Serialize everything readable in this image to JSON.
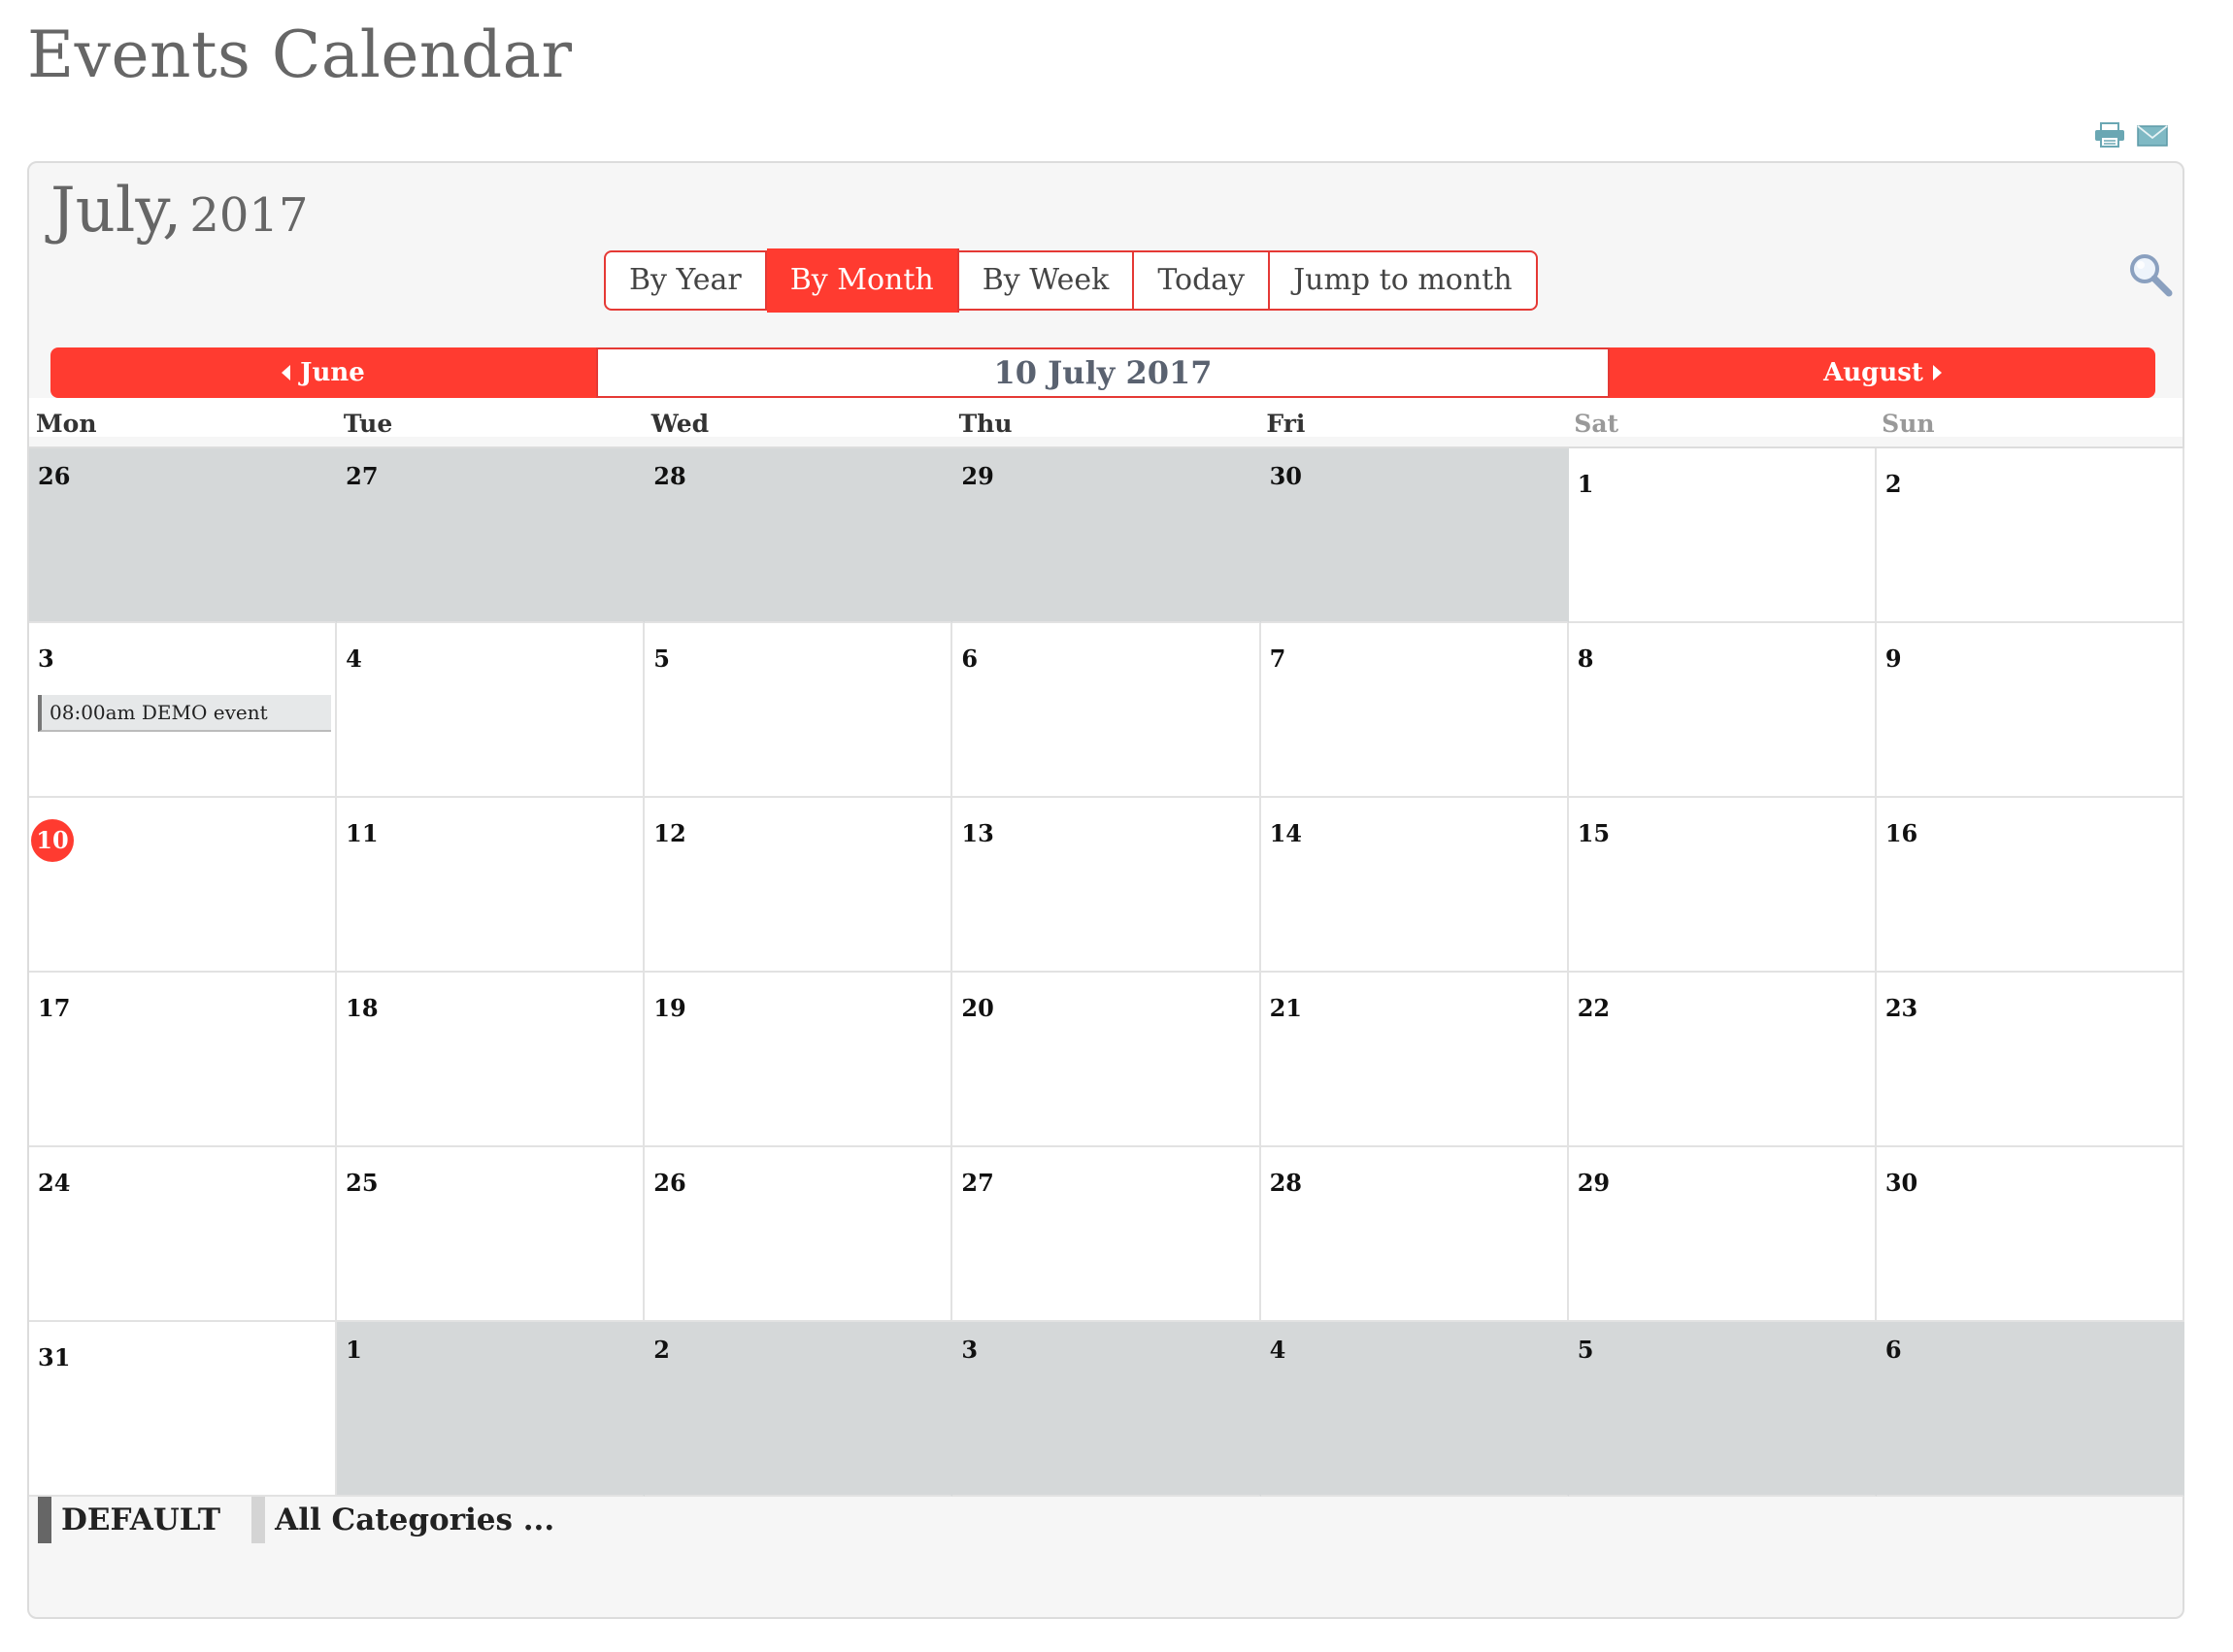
{
  "page": {
    "title": "Events Calendar"
  },
  "toolbar": {
    "print_icon": "printer-icon",
    "email_icon": "envelope-icon"
  },
  "calendar": {
    "month_name": "July,",
    "year": "2017",
    "view_tabs": [
      {
        "label": "By Year",
        "active": false
      },
      {
        "label": "By Month",
        "active": true
      },
      {
        "label": "By Week",
        "active": false
      },
      {
        "label": "Today",
        "active": false
      },
      {
        "label": "Jump to month",
        "active": false
      }
    ],
    "search_icon": "magnifier-icon",
    "nav": {
      "prev_label": "June",
      "current_label": "10 July 2017",
      "next_label": "August"
    },
    "weekdays": [
      "Mon",
      "Tue",
      "Wed",
      "Thu",
      "Fri",
      "Sat",
      "Sun"
    ],
    "weeks": [
      [
        {
          "day": "26",
          "other": true
        },
        {
          "day": "27",
          "other": true
        },
        {
          "day": "28",
          "other": true
        },
        {
          "day": "29",
          "other": true
        },
        {
          "day": "30",
          "other": true
        },
        {
          "day": "1",
          "other": false
        },
        {
          "day": "2",
          "other": false
        }
      ],
      [
        {
          "day": "3",
          "other": false,
          "event": "08:00am DEMO event"
        },
        {
          "day": "4",
          "other": false
        },
        {
          "day": "5",
          "other": false
        },
        {
          "day": "6",
          "other": false
        },
        {
          "day": "7",
          "other": false
        },
        {
          "day": "8",
          "other": false
        },
        {
          "day": "9",
          "other": false
        }
      ],
      [
        {
          "day": "10",
          "other": false,
          "today": true
        },
        {
          "day": "11",
          "other": false
        },
        {
          "day": "12",
          "other": false
        },
        {
          "day": "13",
          "other": false
        },
        {
          "day": "14",
          "other": false
        },
        {
          "day": "15",
          "other": false
        },
        {
          "day": "16",
          "other": false
        }
      ],
      [
        {
          "day": "17",
          "other": false
        },
        {
          "day": "18",
          "other": false
        },
        {
          "day": "19",
          "other": false
        },
        {
          "day": "20",
          "other": false
        },
        {
          "day": "21",
          "other": false
        },
        {
          "day": "22",
          "other": false
        },
        {
          "day": "23",
          "other": false
        }
      ],
      [
        {
          "day": "24",
          "other": false
        },
        {
          "day": "25",
          "other": false
        },
        {
          "day": "26",
          "other": false
        },
        {
          "day": "27",
          "other": false
        },
        {
          "day": "28",
          "other": false
        },
        {
          "day": "29",
          "other": false
        },
        {
          "day": "30",
          "other": false
        }
      ],
      [
        {
          "day": "31",
          "other": false
        },
        {
          "day": "1",
          "other": true
        },
        {
          "day": "2",
          "other": true
        },
        {
          "day": "3",
          "other": true
        },
        {
          "day": "4",
          "other": true
        },
        {
          "day": "5",
          "other": true
        },
        {
          "day": "6",
          "other": true
        }
      ]
    ],
    "legend": [
      {
        "label": "DEFAULT",
        "color": "#666666"
      },
      {
        "label": "All Categories ...",
        "color": "#d4d4d4"
      }
    ]
  },
  "colors": {
    "accent": "#ff3b30",
    "other_month_bg": "#d5d8d9"
  }
}
